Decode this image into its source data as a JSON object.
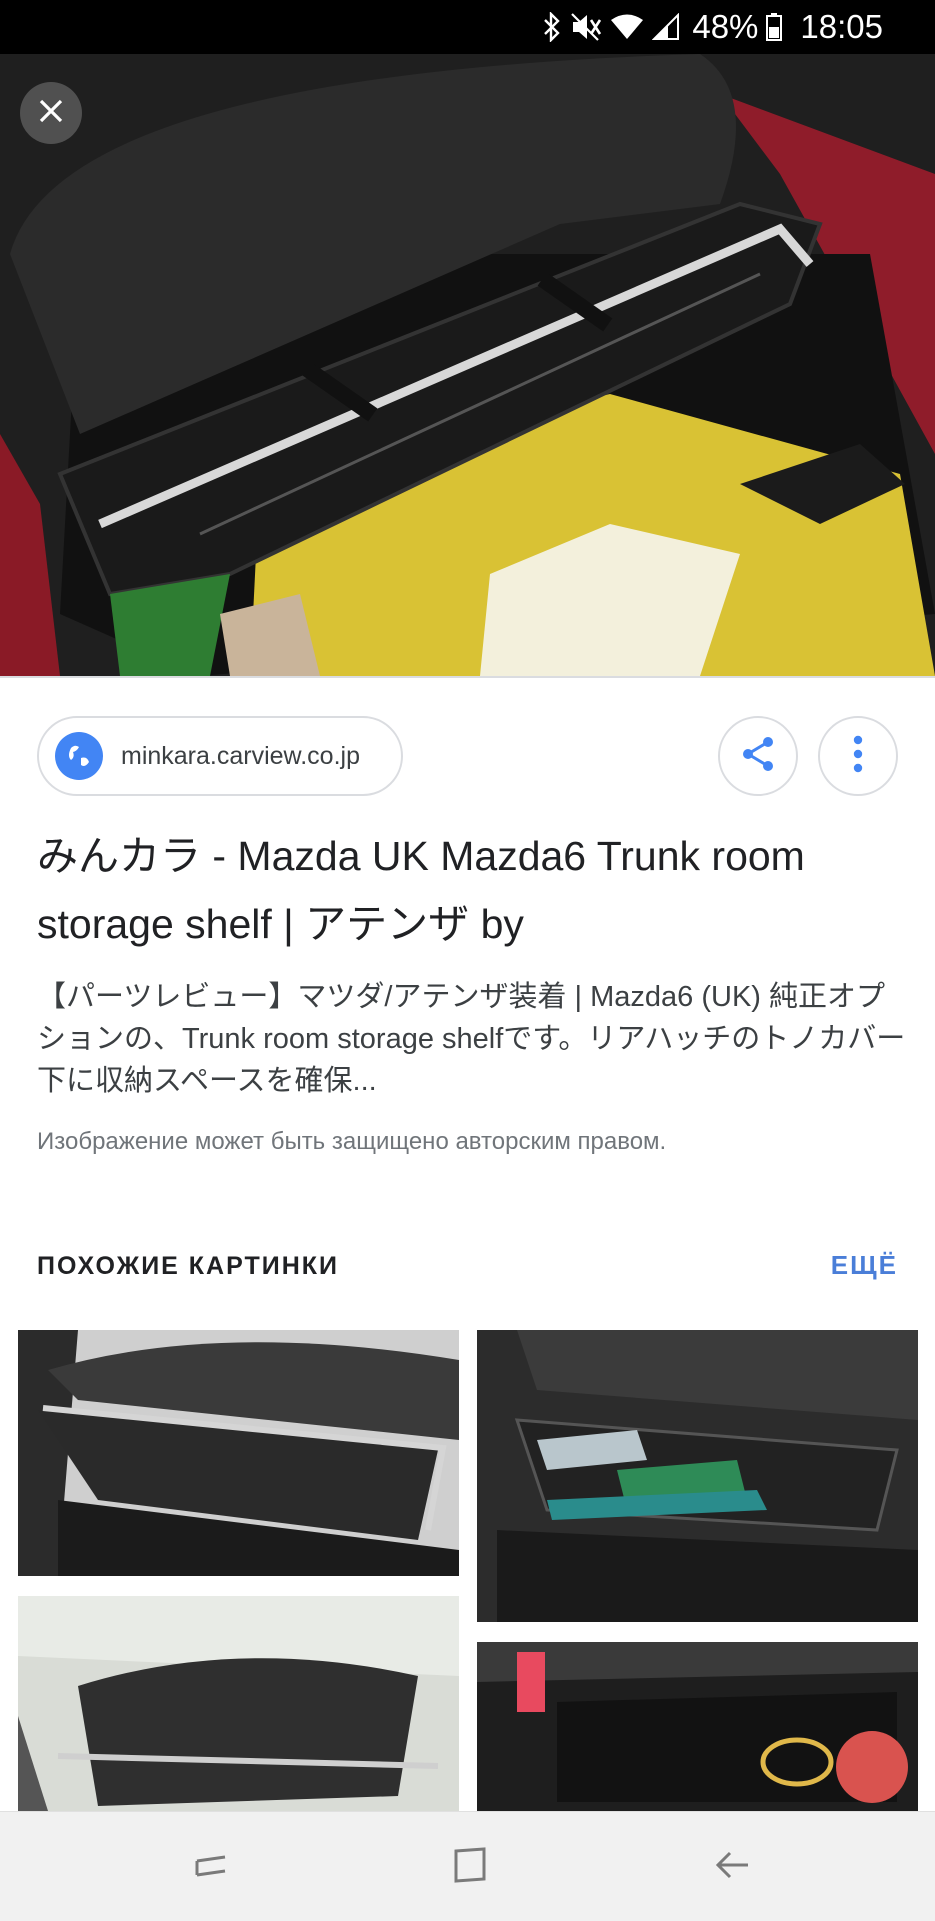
{
  "status_bar": {
    "battery_percent": "48%",
    "time": "18:05",
    "icons": [
      "bluetooth-icon",
      "mute-icon",
      "wifi-icon",
      "signal-icon",
      "battery-icon"
    ]
  },
  "hero": {
    "close_icon": "close-icon"
  },
  "source": {
    "domain": "minkara.carview.co.jp",
    "icon": "globe-icon"
  },
  "actions": {
    "share_icon": "share-icon",
    "more_icon": "more-vertical-icon"
  },
  "result": {
    "title": "みんカラ - Mazda UK Mazda6 Trunk room storage shelf | アテンザ by",
    "snippet": "【パーツレビュー】マツダ/アテンザ装着 | Mazda6 (UK) 純正オプションの、Trunk room storage shelfです。リアハッチのトノカバー下に収納スペースを確保...",
    "copyright_notice": "Изображение может быть защищено авторским правом."
  },
  "related": {
    "heading": "ПОХОЖИЕ КАРТИНКИ",
    "more_label": "ЕЩЁ"
  },
  "nav_bar": {
    "icons": [
      "recents-icon",
      "home-icon",
      "back-icon"
    ]
  },
  "colors": {
    "accent": "#4285f4",
    "link": "#4a7ed8",
    "border": "#dadce0"
  }
}
